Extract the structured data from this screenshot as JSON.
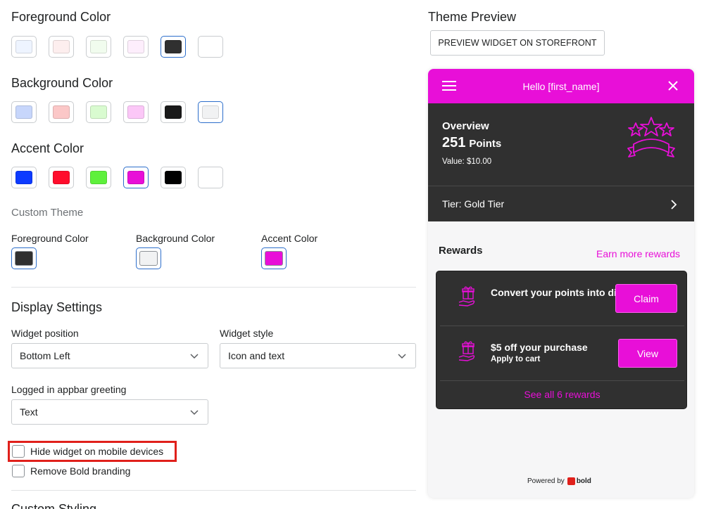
{
  "foreground": {
    "title": "Foreground Color",
    "swatches": [
      "#eef4ff",
      "#fdeeee",
      "#f1fcee",
      "#fdeefc",
      "#303030",
      "#ffffff"
    ],
    "selected_index": 4
  },
  "background": {
    "title": "Background Color",
    "swatches": [
      "#c7d6fb",
      "#fbc7c7",
      "#d9fbd0",
      "#fbc7f7",
      "#1a1a1a",
      "#f1f2f3"
    ],
    "selected_index": 5
  },
  "accent": {
    "title": "Accent Color",
    "swatches": [
      "#0d3bff",
      "#ff0d2c",
      "#5ef03c",
      "#e80fd8",
      "#000000",
      "#ffffff"
    ],
    "selected_index": 3
  },
  "custom_theme": {
    "title": "Custom Theme",
    "foreground_label": "Foreground Color",
    "background_label": "Background Color",
    "accent_label": "Accent Color",
    "foreground_value": "#303030",
    "background_value": "#f1f2f3",
    "accent_value": "#e80fd8"
  },
  "display_settings": {
    "title": "Display Settings",
    "widget_position_label": "Widget position",
    "widget_position_value": "Bottom Left",
    "widget_style_label": "Widget style",
    "widget_style_value": "Icon and text",
    "greeting_label": "Logged in appbar greeting",
    "greeting_value": "Text",
    "hide_mobile_label": "Hide widget on mobile devices",
    "remove_branding_label": "Remove Bold branding"
  },
  "next_section_title": "Custom Styling",
  "preview": {
    "title": "Theme Preview",
    "button_label": "PREVIEW WIDGET ON STOREFRONT",
    "header_greeting": "Hello [first_name]",
    "overview_label": "Overview",
    "points_number": "251",
    "points_label": "Points",
    "value_text": "Value: $10.00",
    "tier_text": "Tier: Gold Tier",
    "rewards_title": "Rewards",
    "earn_more": "Earn more rewards",
    "rewards": [
      {
        "title": "Convert your points into discount",
        "subtitle": "",
        "button": "Claim"
      },
      {
        "title": "$5 off your purchase",
        "subtitle": "Apply to cart",
        "button": "View"
      }
    ],
    "see_all": "See all 6 rewards",
    "powered_by": "Powered by",
    "brand": "bold"
  }
}
